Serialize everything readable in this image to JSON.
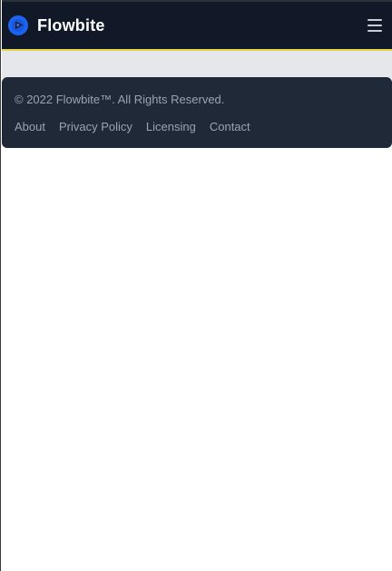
{
  "navbar": {
    "brand": "Flowbite",
    "logo_icon": "flowbite-logo-icon",
    "menu_icon": "hamburger-menu-icon"
  },
  "footer": {
    "copyright": "© 2022 Flowbite™. All Rights Reserved.",
    "links": [
      {
        "label": "About"
      },
      {
        "label": "Privacy Policy"
      },
      {
        "label": "Licensing"
      },
      {
        "label": "Contact"
      }
    ]
  },
  "colors": {
    "navbar_bg": "#111827",
    "navbar_border": "#e3d34a",
    "band_bg": "#e5e7eb",
    "footer_bg": "#1f2937",
    "accent": "#1c64f2",
    "text_muted": "#9ca3af"
  }
}
